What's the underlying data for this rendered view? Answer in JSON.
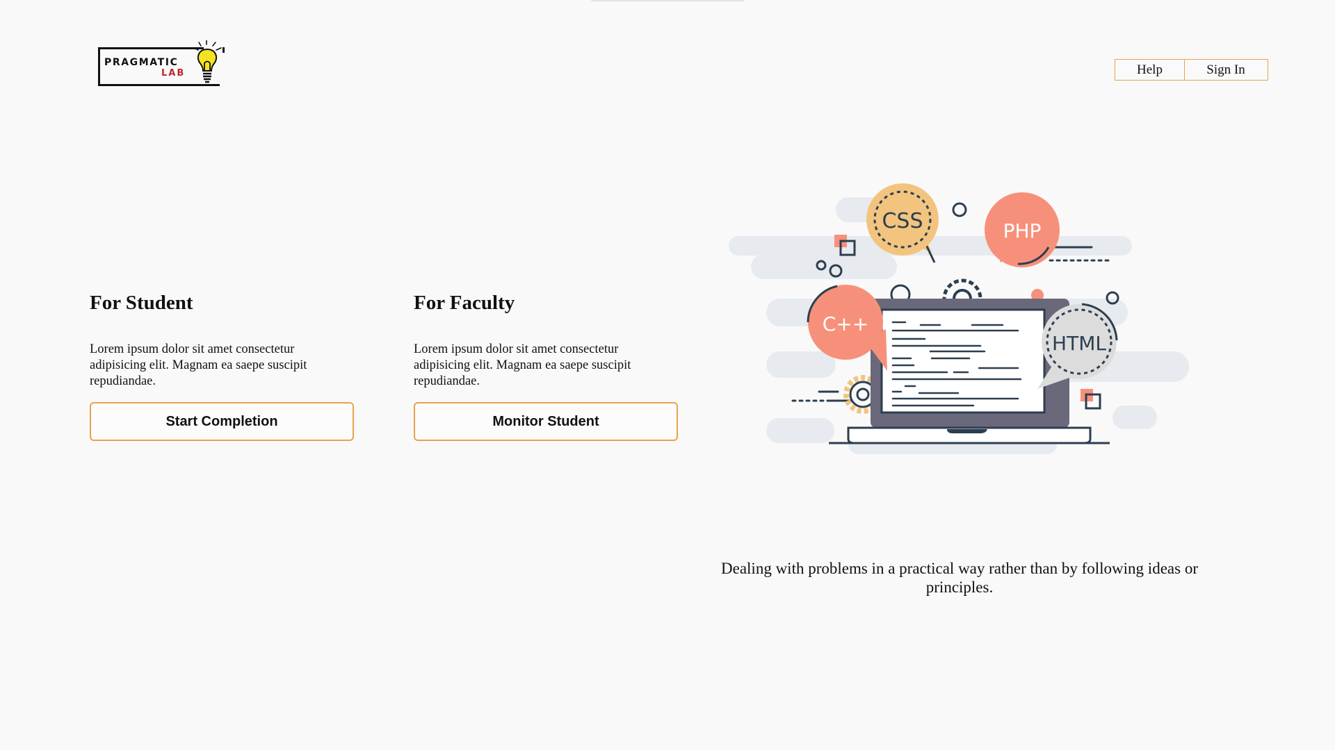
{
  "header": {
    "logo": {
      "line1": "PRAGMATIC",
      "line2": "LAB"
    },
    "nav": {
      "help_label": "Help",
      "signin_label": "Sign In"
    }
  },
  "student": {
    "title": "For Student",
    "description": "Lorem ipsum dolor sit amet consectetur adipisicing elit. Magnam ea saepe suscipit repudiandae.",
    "button_label": "Start Completion"
  },
  "faculty": {
    "title": "For Faculty",
    "description": "Lorem ipsum dolor sit amet consectetur adipisicing elit. Magnam ea saepe suscipit repudiandae.",
    "button_label": "Monitor Student"
  },
  "illustration": {
    "bubbles": {
      "css": "CSS",
      "php": "PHP",
      "cpp": "C++",
      "html": "HTML"
    }
  },
  "tagline": "Dealing with problems in a practical way rather than by following ideas or principles.",
  "colors": {
    "accent": "#e8a24e",
    "logo_red": "#c0242f",
    "bubble_orange": "#f7907b",
    "bubble_yellow": "#f2c47e",
    "bubble_gray": "#dcdcdc",
    "laptop": "#6a687b",
    "outline": "#2c3e4f"
  }
}
